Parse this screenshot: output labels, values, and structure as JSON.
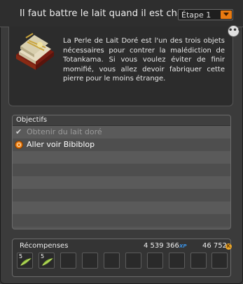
{
  "window": {
    "title": "Il faut battre le lait quand il est chaud",
    "step_select": {
      "selected": "Étape 1"
    }
  },
  "description": {
    "icon": "pearl-book-icon",
    "text": "La Perle de Lait Doré est l'un des trois objets nécessaires pour contrer la malédiction de Totankama. Si vous voulez éviter de finir momifié, vous allez devoir fabriquer cette pierre pour le moins étrange."
  },
  "objectives": {
    "header": "Objectifs",
    "items": [
      {
        "label": "Obtenir du lait doré",
        "status": "done"
      },
      {
        "label": "Aller voir Bibiblop",
        "status": "active"
      }
    ]
  },
  "rewards": {
    "label": "Récompenses",
    "xp": "4 539 366",
    "xp_tag": "XP",
    "kamas": "46 752",
    "kamas_tag": "K",
    "items": [
      {
        "qty": "5",
        "icon": "leaf-icon"
      },
      {
        "qty": "5",
        "icon": "leaf-icon"
      }
    ],
    "empty_slots": 8
  },
  "colors": {
    "accent_orange": "#e97a10",
    "xp_blue": "#3a8fe0",
    "kamas_gold": "#e9a52a"
  }
}
